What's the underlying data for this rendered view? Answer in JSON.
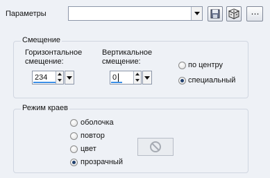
{
  "toolbar": {
    "preset_label": "Параметры",
    "preset_value": "",
    "save_icon": "floppy-disk-icon",
    "random_icon": "dice-icon",
    "more_label": "⋯"
  },
  "offset": {
    "title": "Смещение",
    "horizontal_label_line1": "Горизонтальное",
    "horizontal_label_line2": "смещение:",
    "horizontal_value": "234",
    "vertical_label_line1": "Вертикальное",
    "vertical_label_line2": "смещение:",
    "vertical_value": "0",
    "center_label": "по центру",
    "custom_label": "специальный",
    "selected": "custom"
  },
  "edge_mode": {
    "title": "Режим краев",
    "options": [
      "оболочка",
      "повтор",
      "цвет",
      "прозрачный"
    ],
    "selected": "прозрачный",
    "color_swatch_icon": "no-entry-icon"
  }
}
